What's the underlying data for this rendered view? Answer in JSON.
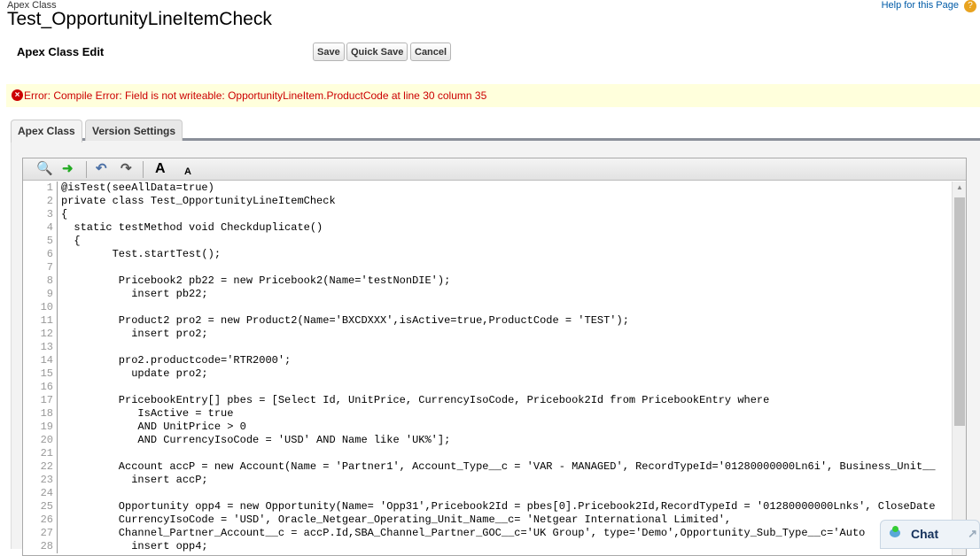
{
  "breadcrumb": "Apex Class",
  "page_title": "Test_OpportunityLineItemCheck",
  "help_link": "Help for this Page",
  "section_title": "Apex Class Edit",
  "buttons": {
    "save": "Save",
    "quick_save": "Quick Save",
    "cancel": "Cancel"
  },
  "error_message": "Error: Compile Error: Field is not writeable: OpportunityLineItem.ProductCode at line 30 column 35",
  "tabs": [
    "Apex Class",
    "Version Settings"
  ],
  "toolbar": {
    "font_larger": "A",
    "font_smaller": "A"
  },
  "code_lines": [
    "@isTest(seeAllData=true)",
    "private class Test_OpportunityLineItemCheck",
    "{",
    "  static testMethod void Checkduplicate()",
    "  {",
    "        Test.startTest();",
    "",
    "         Pricebook2 pb22 = new Pricebook2(Name='testNonDIE');",
    "           insert pb22;",
    "",
    "         Product2 pro2 = new Product2(Name='BXCDXXX',isActive=true,ProductCode = 'TEST');",
    "           insert pro2;",
    "",
    "         pro2.productcode='RTR2000';",
    "           update pro2;",
    "",
    "         PricebookEntry[] pbes = [Select Id, UnitPrice, CurrencyIsoCode, Pricebook2Id from PricebookEntry where",
    "            IsActive = true",
    "            AND UnitPrice > 0",
    "            AND CurrencyIsoCode = 'USD' AND Name like 'UK%'];",
    "",
    "         Account accP = new Account(Name = 'Partner1', Account_Type__c = 'VAR - MANAGED', RecordTypeId='01280000000Ln6i', Business_Unit__",
    "           insert accP;",
    "",
    "         Opportunity opp4 = new Opportunity(Name= 'Opp31',Pricebook2Id = pbes[0].Pricebook2Id,RecordTypeId = '01280000000Lnks', CloseDate",
    "         CurrencyIsoCode = 'USD', Oracle_Netgear_Operating_Unit_Name__c= 'Netgear International Limited',",
    "         Channel_Partner_Account__c = accP.Id,SBA_Channel_Partner_GOC__c='UK Group', type='Demo',Opportunity_Sub_Type__c='Auto",
    "           insert opp4;"
  ],
  "chat_label": "Chat",
  "colors": {
    "error": "#cc0000",
    "error_bg": "#ffffdc",
    "string": "#2a7f2a",
    "link": "#015ba7"
  }
}
